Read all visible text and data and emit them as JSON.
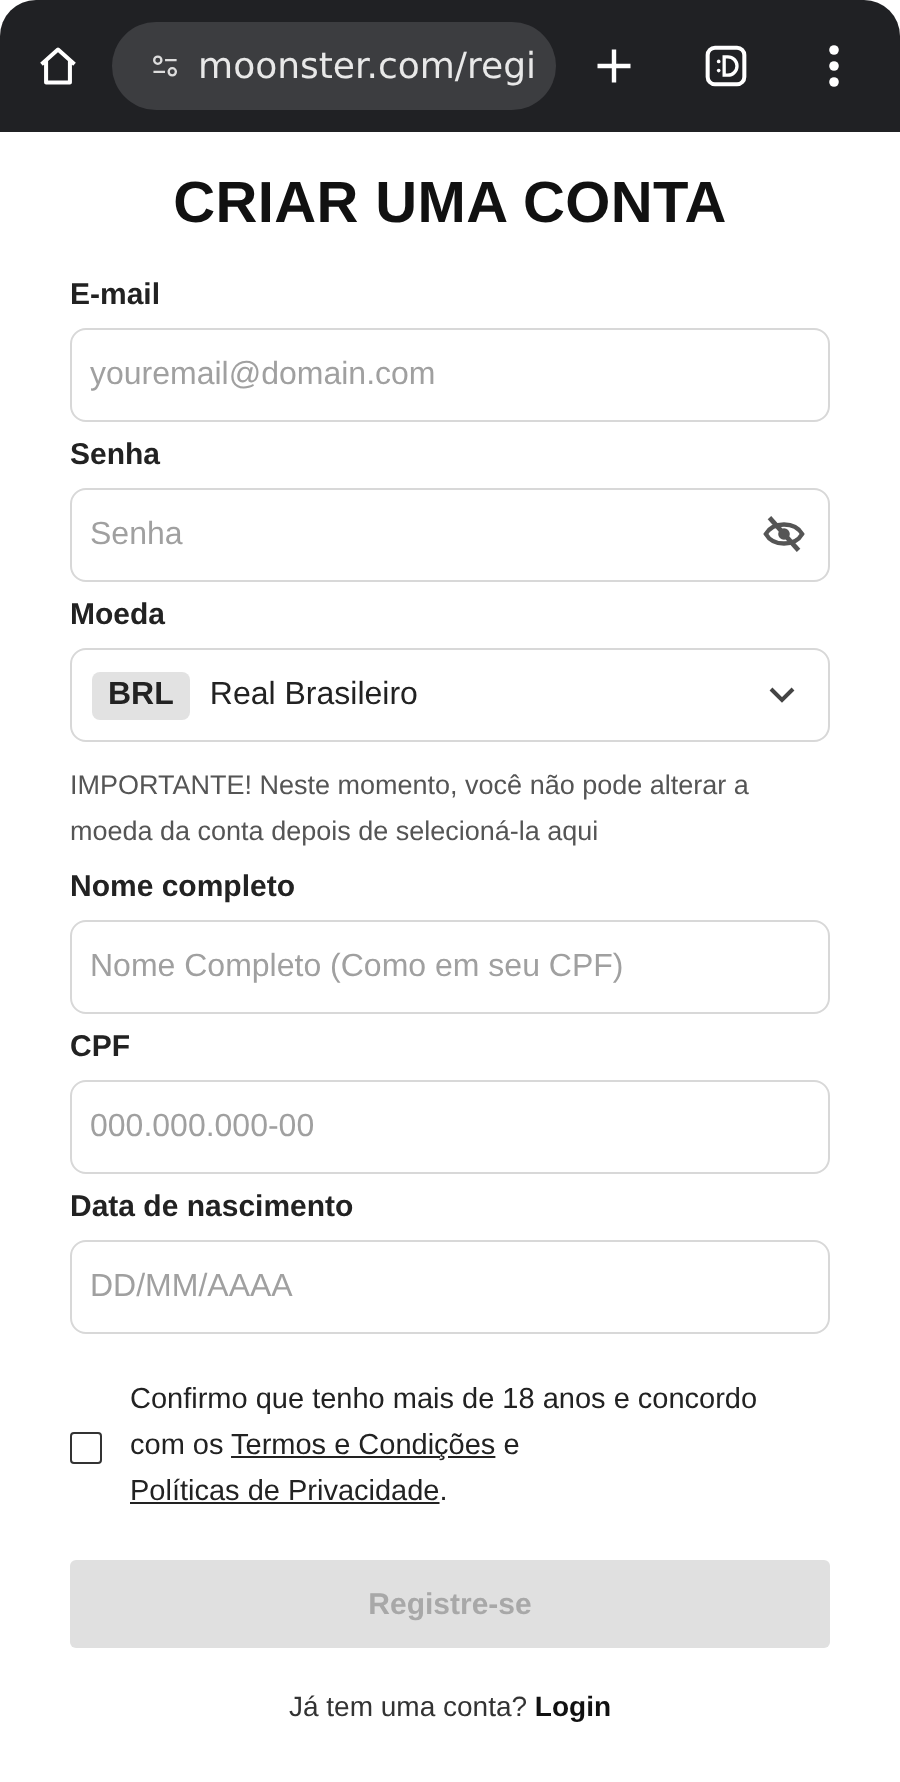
{
  "browser": {
    "url": "moonster.com/regi"
  },
  "title": "CRIAR UMA CONTA",
  "fields": [
    {
      "kind": "text",
      "label": "E-mail",
      "placeholder": "youremail@domain.com"
    },
    {
      "kind": "password",
      "label": "Senha",
      "placeholder": "Senha"
    },
    {
      "kind": "select",
      "label": "Moeda",
      "code": "BRL",
      "value": "Real Brasileiro",
      "note": "IMPORTANTE! Neste momento, você não pode alterar a moeda da conta depois de selecioná-la aqui"
    },
    {
      "kind": "text",
      "label": "Nome completo",
      "placeholder": "Nome Completo (Como em seu CPF)"
    },
    {
      "kind": "text",
      "label": "CPF",
      "placeholder": "000.000.000-00"
    },
    {
      "kind": "text",
      "label": "Data de nascimento",
      "placeholder": "DD/MM/AAAA"
    }
  ],
  "consent": {
    "checked": false,
    "parts": [
      {
        "kind": "text",
        "text": "Confirmo que tenho mais de 18 anos e concordo com os "
      },
      {
        "kind": "link",
        "text": "Termos e Condições"
      },
      {
        "kind": "text",
        "text": " e "
      },
      {
        "kind": "link",
        "text": "Políticas de Privacidade"
      },
      {
        "kind": "text",
        "text": "."
      }
    ]
  },
  "submit": {
    "label": "Registre-se",
    "disabled": true
  },
  "login": {
    "prompt": "Já tem uma conta?",
    "link": "Login"
  }
}
